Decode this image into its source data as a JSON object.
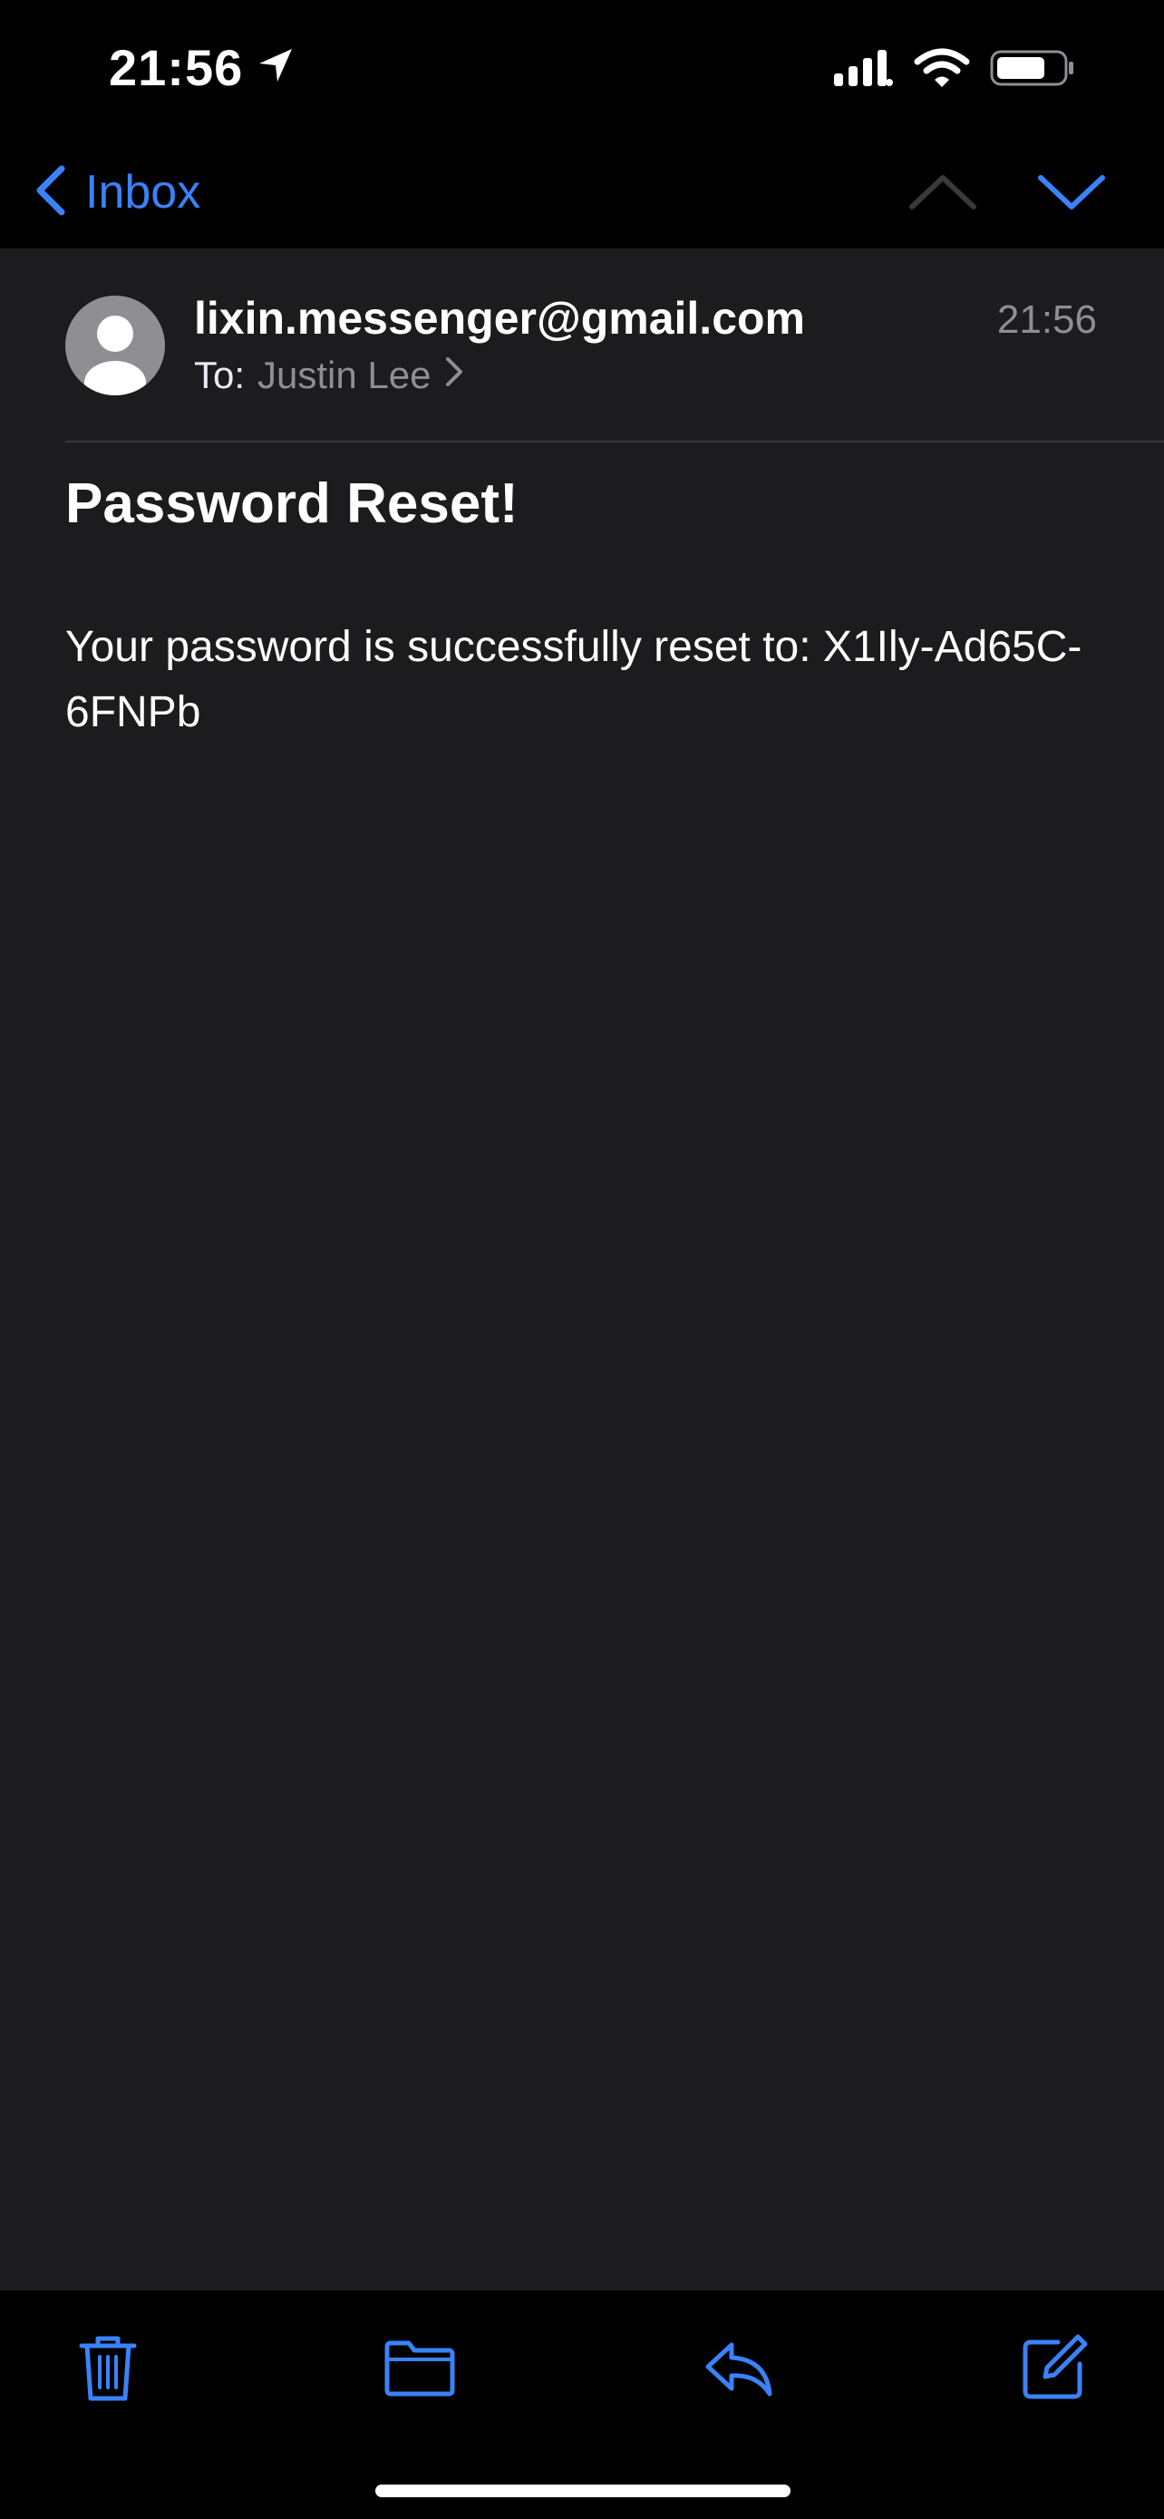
{
  "status_bar": {
    "time": "21:56"
  },
  "nav": {
    "back_label": "Inbox"
  },
  "message": {
    "sender": "lixin.messenger@gmail.com",
    "time": "21:56",
    "to_label": "To:",
    "to_name": "Justin Lee",
    "subject": "Password Reset!",
    "body": "Your password is successfully reset to: X1Ily-Ad65C-6FNPb"
  },
  "colors": {
    "accent": "#3a82f7",
    "background": "#1c1c1e",
    "bars": "#000000",
    "secondary_text": "#8e8e93"
  },
  "icons": {
    "location": "location-arrow-icon",
    "signal": "cellular-signal-icon",
    "wifi": "wifi-icon",
    "battery": "battery-icon",
    "back": "chevron-left-icon",
    "up": "chevron-up-icon",
    "down": "chevron-down-icon",
    "avatar": "person-icon",
    "to_chevron": "chevron-right-icon",
    "trash": "trash-icon",
    "folder": "folder-icon",
    "reply": "reply-icon",
    "compose": "compose-icon"
  }
}
